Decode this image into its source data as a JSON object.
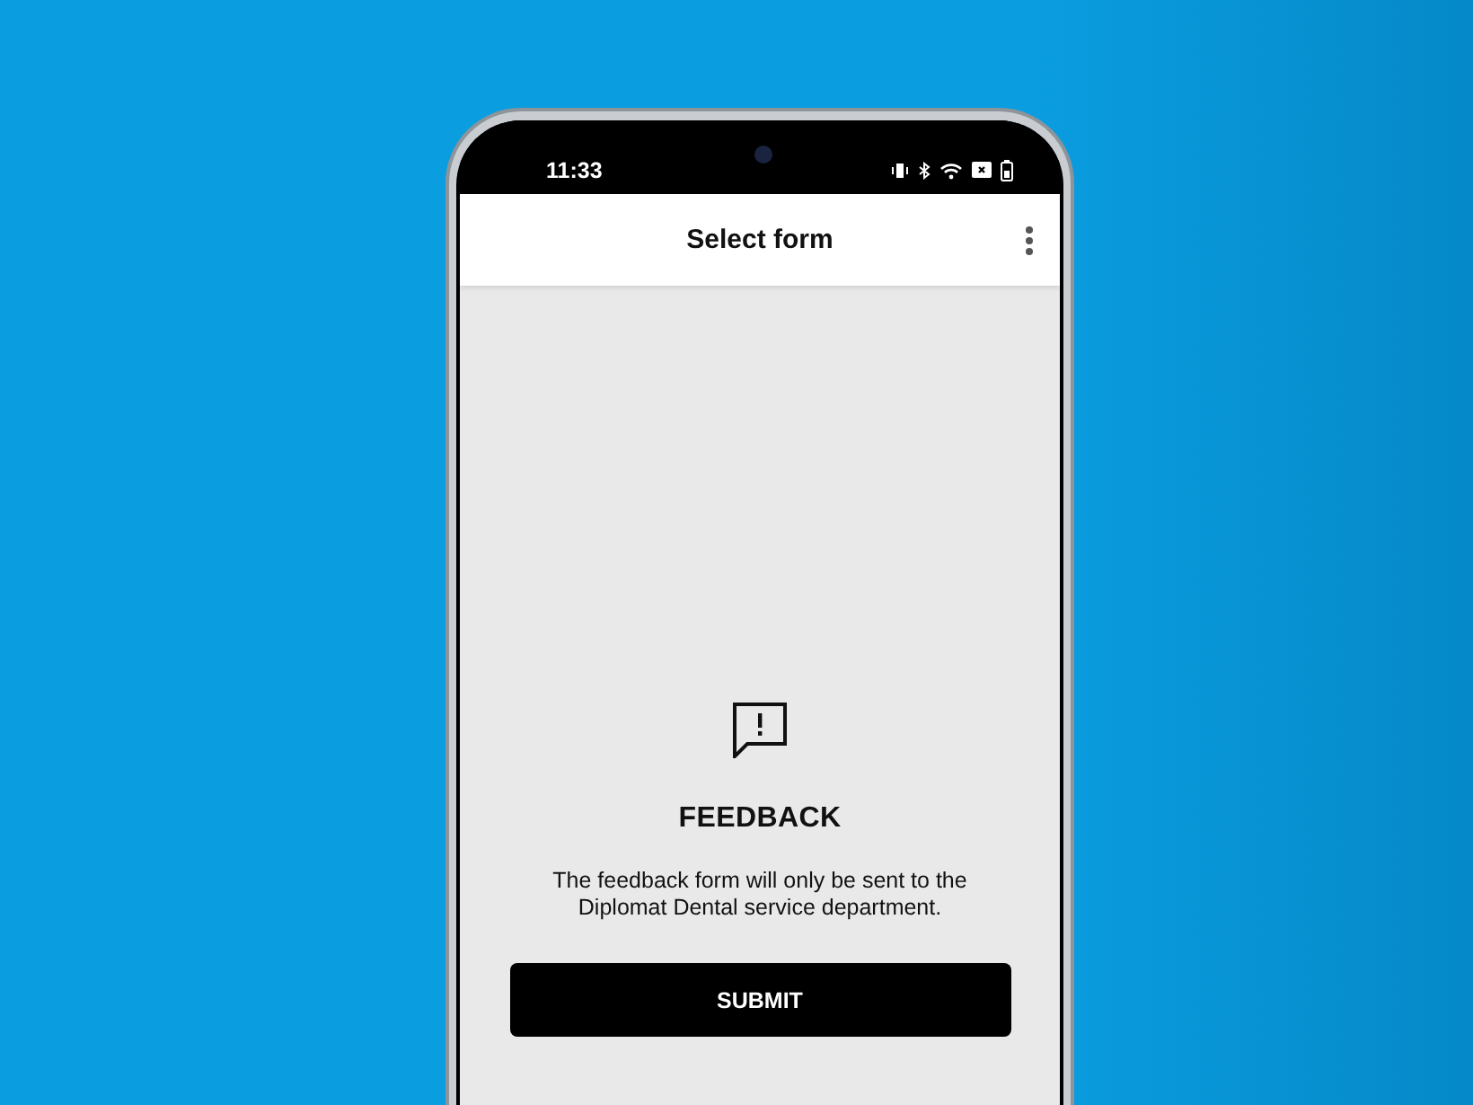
{
  "status_bar": {
    "time": "11:33"
  },
  "app_bar": {
    "title": "Select form"
  },
  "form": {
    "title": "FEEDBACK",
    "description": "The feedback form will only be sent to the Diplomat Dental service department.",
    "button": "SUBMIT"
  }
}
